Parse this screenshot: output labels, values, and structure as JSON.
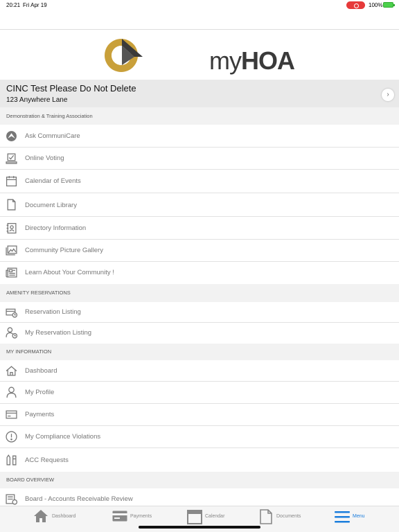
{
  "status_bar": {
    "time": "20:21",
    "date": "Fri Apr 19",
    "battery": "100%"
  },
  "brand": {
    "name_light": "my",
    "name_bold": "HOA",
    "icon": "hoa-logo-icon"
  },
  "account": {
    "name": "CINC Test Please Do Not Delete",
    "address": "123 Anywhere Lane"
  },
  "sections": {
    "association": {
      "title": "Demonstration & Training Association"
    },
    "amenity": {
      "title": "AMENITY RESERVATIONS"
    },
    "my_info": {
      "title": "MY INFORMATION"
    },
    "board": {
      "title": "BOARD OVERVIEW"
    }
  },
  "menu": {
    "ask_communicare": {
      "label": "Ask CommuniCare",
      "icon": "communicare-icon"
    },
    "online_voting": {
      "label": "Online Voting",
      "icon": "ballot-icon"
    },
    "calendar": {
      "label": "Calendar of Events",
      "icon": "calendar-icon"
    },
    "document_library": {
      "label": "Document Library",
      "icon": "document-icon"
    },
    "directory": {
      "label": "Directory Information",
      "icon": "contact-book-icon"
    },
    "gallery": {
      "label": "Community Picture Gallery",
      "icon": "picture-icon"
    },
    "learn": {
      "label": "Learn About Your Community !",
      "icon": "newspaper-icon"
    },
    "reservation_listing": {
      "label": "Reservation Listing",
      "icon": "reservation-icon"
    },
    "my_reservation_listing": {
      "label": "My Reservation Listing",
      "icon": "person-clock-icon"
    },
    "dashboard": {
      "label": "Dashboard",
      "icon": "home-icon"
    },
    "my_profile": {
      "label": "My Profile",
      "icon": "person-icon"
    },
    "payments": {
      "label": "Payments",
      "icon": "payment-card-icon"
    },
    "violations": {
      "label": "My Compliance Violations",
      "icon": "alert-circle-icon"
    },
    "acc_requests": {
      "label": "ACC Requests",
      "icon": "tools-icon"
    },
    "ar_review": {
      "label": "Board - Accounts Receivable Review",
      "icon": "report-icon"
    }
  },
  "tabs": {
    "dashboard": {
      "label": "Dashboard",
      "icon": "home-icon"
    },
    "payments": {
      "label": "Payments",
      "icon": "payment-card-icon"
    },
    "calendar": {
      "label": "Calendar",
      "icon": "calendar-icon"
    },
    "documents": {
      "label": "Documents",
      "icon": "document-icon"
    },
    "menu": {
      "label": "Menu",
      "icon": "hamburger-icon",
      "active": true
    }
  },
  "colors": {
    "accent": "#1a7ddc",
    "logo_gold": "#c9a03a",
    "logo_dark": "#3a3a3a",
    "record": "#e63a3a"
  }
}
